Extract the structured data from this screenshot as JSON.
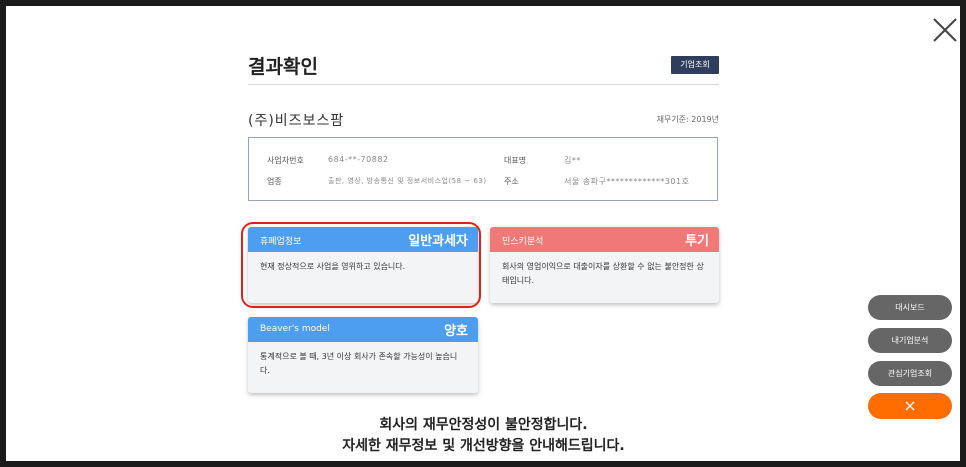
{
  "header": {
    "title": "결과확인",
    "lookup_button": "기업조회"
  },
  "company": {
    "name": "(주)비즈보스팜",
    "basis": "재무기준: 2019년"
  },
  "info": {
    "biz_no_label": "사업자번호",
    "biz_no_value": "684-**-70882",
    "industry_label": "업종",
    "industry_value": "출판, 영상, 방송통신 및 정보서비스업(58 ~ 63)",
    "ceo_label": "대표명",
    "ceo_value": "김**",
    "address_label": "주소",
    "address_value": "서울 송파구*************301호"
  },
  "cards": [
    {
      "label": "휴폐업정보",
      "status": "일반과세자",
      "text": "현재 정상적으로 사업을 영위하고 있습니다.",
      "color": "#4d9ef0"
    },
    {
      "label": "민스키분석",
      "status": "투기",
      "text": "회사의 영업이익으로 대출이자를 상환할 수 없는 불안정한 상태입니다.",
      "color": "#f07978"
    },
    {
      "label": "Beaver's model",
      "status": "양호",
      "text": "통계적으로 볼 때, 3년 이상 회사가 존속할 가능성이 높습니다.",
      "color": "#4d9ef0"
    }
  ],
  "message": {
    "line1": "회사의 재무안정성이 불안정합니다.",
    "line2": "자세한 재무정보 및 개선방향을 안내해드립니다."
  },
  "side_menu": {
    "dashboard": "대시보드",
    "my_analysis": "내기업분석",
    "interest": "관심기업조회",
    "close_icon": "close-icon"
  },
  "colors": {
    "accent_orange": "#ff6d00",
    "navy": "#2f3e5c",
    "highlight_red": "#e02020"
  }
}
